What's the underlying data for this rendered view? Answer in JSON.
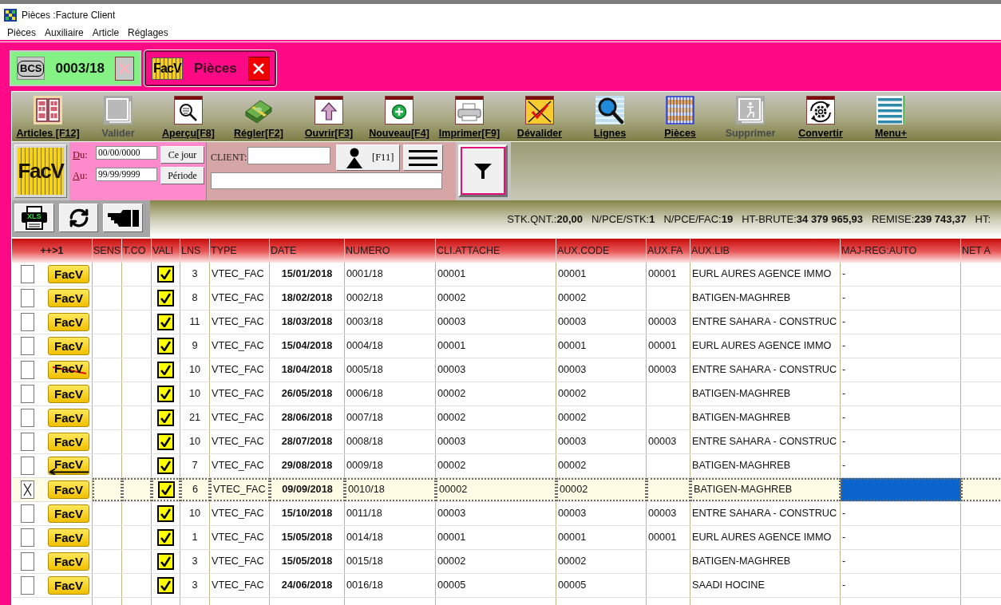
{
  "window": {
    "title": "Pièces :Facture Client"
  },
  "menu": [
    "Pièces",
    "Auxiliaire",
    "Article",
    "Réglages"
  ],
  "tabs": [
    {
      "kind": "bcs",
      "badge": "BCS",
      "label": "0003/18",
      "selected": false
    },
    {
      "kind": "facv",
      "badge": "FacV",
      "label": "Pièces",
      "selected": true
    }
  ],
  "toolbar": [
    {
      "kind": "articles",
      "label": "Articles [F12]",
      "disabled": false
    },
    {
      "kind": "validate",
      "label": "Valider",
      "disabled": true
    },
    {
      "kind": "preview",
      "label": "Aperçu[F8]",
      "disabled": false
    },
    {
      "kind": "pay",
      "label": "Régler[F2]",
      "disabled": false
    },
    {
      "kind": "open",
      "label": "Ouvrir[F3]",
      "disabled": false
    },
    {
      "kind": "new",
      "label": "Nouveau[F4]",
      "disabled": false
    },
    {
      "kind": "print",
      "label": "Imprimer[F9]",
      "disabled": false
    },
    {
      "kind": "unvalidate",
      "label": "Dévalider",
      "disabled": false
    },
    {
      "kind": "lines",
      "label": "Lignes",
      "disabled": false
    },
    {
      "kind": "pieces",
      "label": "Pièces",
      "disabled": false
    },
    {
      "kind": "delete",
      "label": "Supprimer",
      "disabled": true
    },
    {
      "kind": "convert",
      "label": "Convertir",
      "disabled": false
    },
    {
      "kind": "menu",
      "label": "Menu+",
      "disabled": false
    }
  ],
  "filter": {
    "logo": "FacV",
    "from": {
      "label": "Du:",
      "value": "00/00/0000",
      "button": "Ce jour"
    },
    "to": {
      "label": "Au:",
      "value": "99/99/9999",
      "button": "Période"
    },
    "client": {
      "label": "CLIENT:",
      "button": "[F11]"
    }
  },
  "actions": [
    {
      "kind": "xls",
      "text": "XLS"
    },
    {
      "kind": "refresh"
    },
    {
      "kind": "pointer"
    }
  ],
  "stats": [
    "STK.QNT.:**20,00**",
    "N/PCE/STK:**1**",
    "N/PCE/FAC:**19**",
    "HT-BRUTE:**34 379 965,93**",
    "REMISE:**239 743,37**",
    "HT:"
  ],
  "table": {
    "columns": [
      "++>1",
      "SENS",
      "T.CO",
      "VALI",
      "LNS",
      "TYPE",
      "DATE",
      "NUMERO",
      "CLI.ATTACHE",
      "AUX.CODE",
      "AUX.FA",
      "AUX.LIB",
      "MAJ-REG:AUTO",
      "NET A"
    ],
    "rows": [
      {
        "kind": "normal",
        "checked": false,
        "selected": false,
        "badge": "FacV",
        "valid": true,
        "lns": "3",
        "type": "VTEC_FAC",
        "date": "15/01/2018",
        "numero": "0001/18",
        "cli_attache": "00001",
        "aux_code": "00001",
        "aux_fam": "00001",
        "aux_lib": "EURL AURES AGENCE IMMO",
        "maj_reg": "-"
      },
      {
        "kind": "normal",
        "checked": false,
        "selected": false,
        "badge": "FacV",
        "valid": true,
        "lns": "8",
        "type": "VTEC_FAC",
        "date": "18/02/2018",
        "numero": "0002/18",
        "cli_attache": "00002",
        "aux_code": "00002",
        "aux_lib": "BATIGEN-MAGHREB",
        "maj_reg": "-"
      },
      {
        "kind": "normal",
        "checked": false,
        "selected": false,
        "badge": "FacV",
        "valid": true,
        "lns": "11",
        "type": "VTEC_FAC",
        "date": "18/03/2018",
        "numero": "0003/18",
        "cli_attache": "00003",
        "aux_code": "00003",
        "aux_fam": "00003",
        "aux_lib": "ENTRE SAHARA - CONSTRUC",
        "maj_reg": "-"
      },
      {
        "kind": "normal",
        "checked": false,
        "selected": false,
        "badge": "FacV",
        "valid": true,
        "lns": "9",
        "type": "VTEC_FAC",
        "date": "15/04/2018",
        "numero": "0004/18",
        "cli_attache": "00001",
        "aux_code": "00001",
        "aux_fam": "00001",
        "aux_lib": "EURL AURES AGENCE IMMO",
        "maj_reg": "-"
      },
      {
        "kind": "cancelled",
        "checked": false,
        "selected": false,
        "badge": "FacV",
        "valid": true,
        "lns": "10",
        "type": "VTEC_FAC",
        "date": "18/04/2018",
        "numero": "0005/18",
        "cli_attache": "00003",
        "aux_code": "00003",
        "aux_fam": "00003",
        "aux_lib": "ENTRE SAHARA - CONSTRUC",
        "maj_reg": "-"
      },
      {
        "kind": "normal",
        "checked": false,
        "selected": false,
        "badge": "FacV",
        "valid": true,
        "lns": "10",
        "type": "VTEC_FAC",
        "date": "26/05/2018",
        "numero": "0006/18",
        "cli_attache": "00002",
        "aux_code": "00002",
        "aux_lib": "BATIGEN-MAGHREB",
        "maj_reg": "-"
      },
      {
        "kind": "normal",
        "checked": false,
        "selected": false,
        "badge": "FacV",
        "valid": true,
        "lns": "21",
        "type": "VTEC_FAC",
        "date": "28/06/2018",
        "numero": "0007/18",
        "cli_attache": "00002",
        "aux_code": "00002",
        "aux_lib": "BATIGEN-MAGHREB",
        "maj_reg": "-"
      },
      {
        "kind": "normal",
        "checked": false,
        "selected": false,
        "badge": "FacV",
        "valid": true,
        "lns": "10",
        "type": "VTEC_FAC",
        "date": "28/07/2018",
        "numero": "0008/18",
        "cli_attache": "00003",
        "aux_code": "00003",
        "aux_fam": "00003",
        "aux_lib": "ENTRE SAHARA - CONSTRUC",
        "maj_reg": "-"
      },
      {
        "kind": "returned",
        "checked": false,
        "selected": false,
        "badge": "FacV",
        "valid": true,
        "lns": "7",
        "type": "VTEC_FAC",
        "date": "29/08/2018",
        "numero": "0009/18",
        "cli_attache": "00002",
        "aux_code": "00002",
        "aux_lib": "BATIGEN-MAGHREB",
        "maj_reg": "-"
      },
      {
        "kind": "normal",
        "checked": true,
        "selected": true,
        "badge": "FacV",
        "valid": true,
        "lns": "6",
        "type": "VTEC_FAC",
        "date": "09/09/2018",
        "numero": "0010/18",
        "cli_attache": "00002",
        "aux_code": "00002",
        "aux_lib": "BATIGEN-MAGHREB"
      },
      {
        "kind": "normal",
        "checked": false,
        "selected": false,
        "badge": "FacV",
        "valid": true,
        "lns": "10",
        "type": "VTEC_FAC",
        "date": "15/10/2018",
        "numero": "0011/18",
        "cli_attache": "00003",
        "aux_code": "00003",
        "aux_fam": "00003",
        "aux_lib": "ENTRE SAHARA - CONSTRUC",
        "maj_reg": "-"
      },
      {
        "kind": "normal",
        "checked": false,
        "selected": false,
        "badge": "FacV",
        "valid": true,
        "lns": "1",
        "type": "VTEC_FAC",
        "date": "15/05/2018",
        "numero": "0014/18",
        "cli_attache": "00001",
        "aux_code": "00001",
        "aux_fam": "00001",
        "aux_lib": "EURL AURES AGENCE IMMO",
        "maj_reg": "-"
      },
      {
        "kind": "normal",
        "checked": false,
        "selected": false,
        "badge": "FacV",
        "valid": true,
        "lns": "3",
        "type": "VTEC_FAC",
        "date": "15/05/2018",
        "numero": "0015/18",
        "cli_attache": "00002",
        "aux_code": "00002",
        "aux_lib": "BATIGEN-MAGHREB",
        "maj_reg": "-"
      },
      {
        "kind": "normal",
        "checked": false,
        "selected": false,
        "badge": "FacV",
        "valid": true,
        "lns": "3",
        "type": "VTEC_FAC",
        "date": "24/06/2018",
        "numero": "0016/18",
        "cli_attache": "00005",
        "aux_code": "00005",
        "aux_lib": "SAADI HOCINE",
        "maj_reg": "-"
      }
    ]
  }
}
